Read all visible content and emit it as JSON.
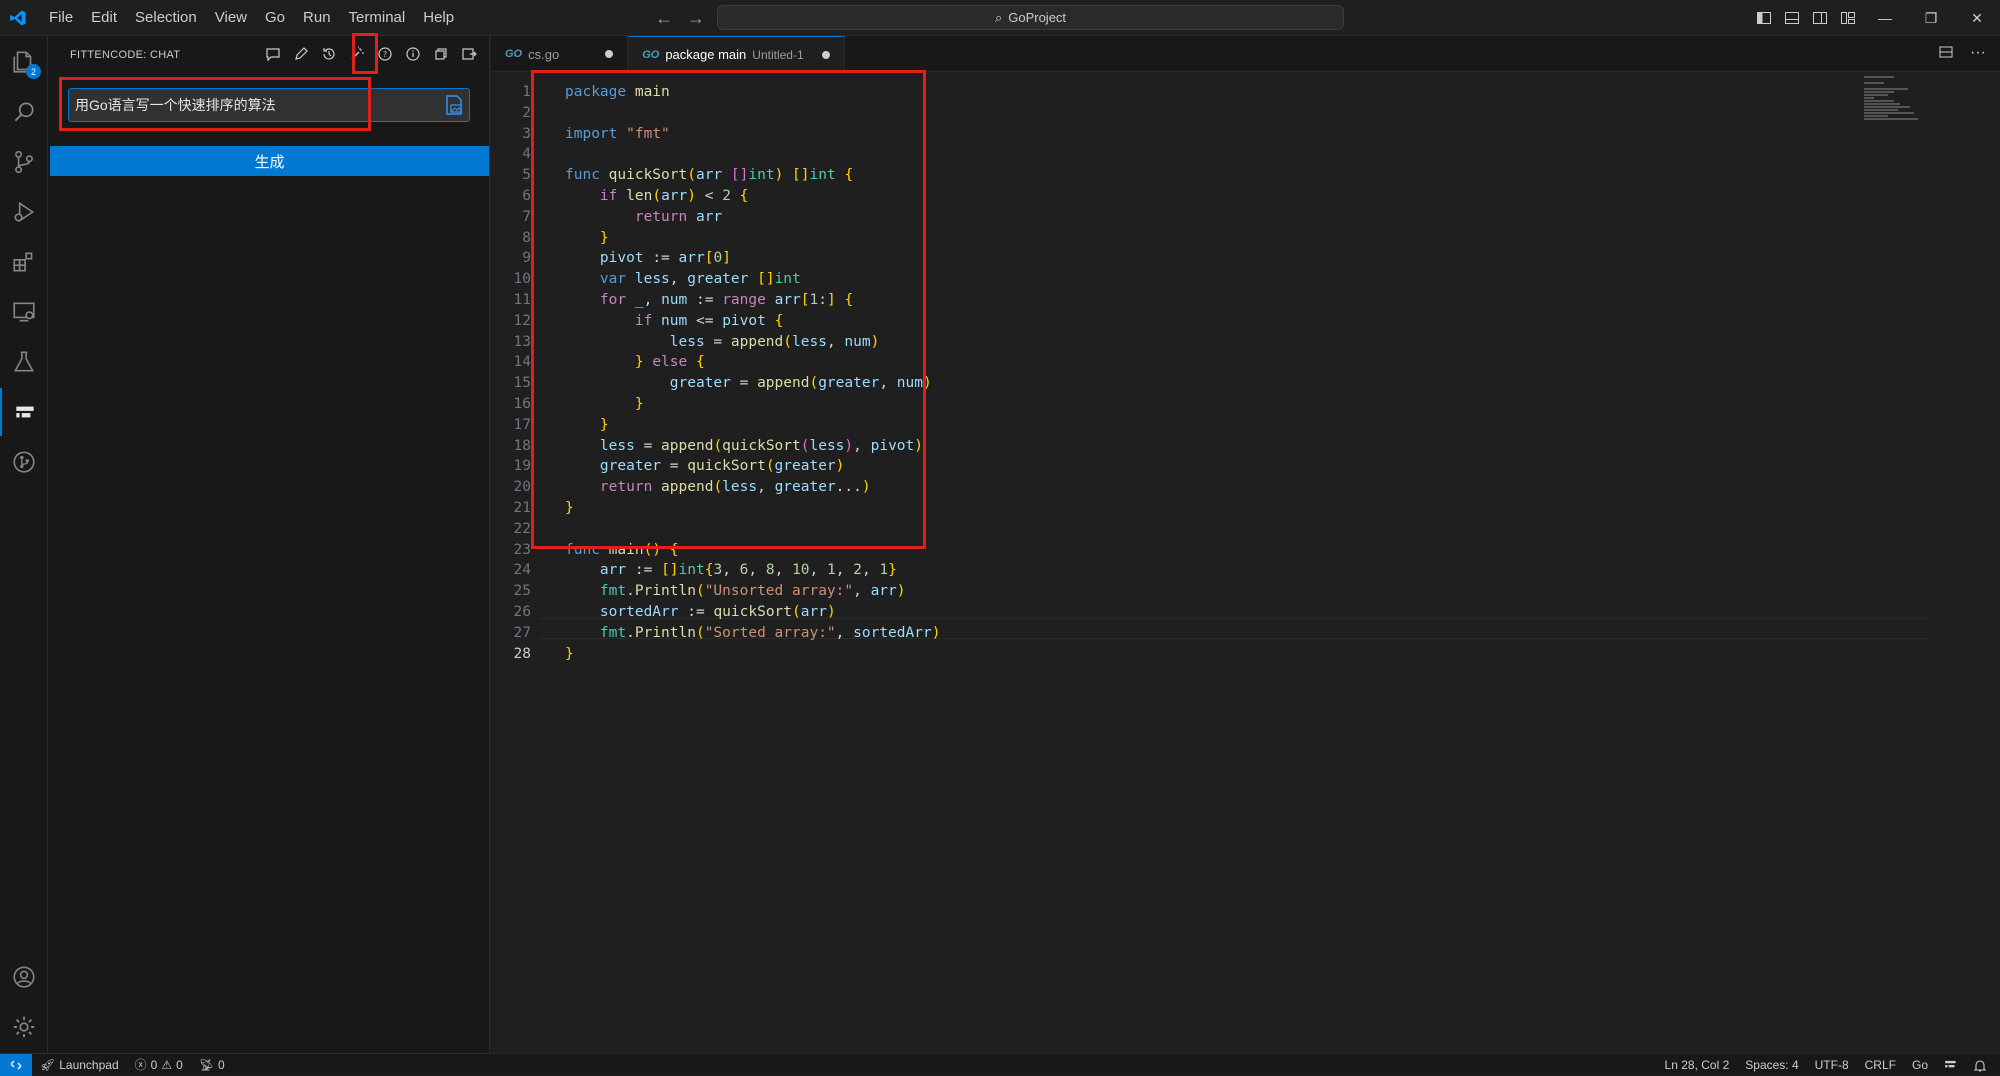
{
  "menu": [
    "File",
    "Edit",
    "Selection",
    "View",
    "Go",
    "Run",
    "Terminal",
    "Help"
  ],
  "command_center": "GoProject",
  "activity_badge": "2",
  "sidebar": {
    "title": "FITTENCODE: CHAT",
    "input_value": "用Go语言写一个快速排序的算法",
    "generate_label": "生成"
  },
  "tabs": [
    {
      "icon": "GO",
      "label": "cs.go",
      "sub": ""
    },
    {
      "icon": "GO",
      "label": "package main",
      "sub": "Untitled-1"
    }
  ],
  "code_lines": [
    {
      "n": "1",
      "t": "package main"
    },
    {
      "n": "2",
      "t": ""
    },
    {
      "n": "3",
      "t": "import \"fmt\""
    },
    {
      "n": "4",
      "t": ""
    },
    {
      "n": "5",
      "t": "func quickSort(arr []int) []int {"
    },
    {
      "n": "6",
      "t": "    if len(arr) < 2 {"
    },
    {
      "n": "7",
      "t": "        return arr"
    },
    {
      "n": "8",
      "t": "    }"
    },
    {
      "n": "9",
      "t": "    pivot := arr[0]"
    },
    {
      "n": "10",
      "t": "    var less, greater []int"
    },
    {
      "n": "11",
      "t": "    for _, num := range arr[1:] {"
    },
    {
      "n": "12",
      "t": "        if num <= pivot {"
    },
    {
      "n": "13",
      "t": "            less = append(less, num)"
    },
    {
      "n": "14",
      "t": "        } else {"
    },
    {
      "n": "15",
      "t": "            greater = append(greater, num)"
    },
    {
      "n": "16",
      "t": "        }"
    },
    {
      "n": "17",
      "t": "    }"
    },
    {
      "n": "18",
      "t": "    less = append(quickSort(less), pivot)"
    },
    {
      "n": "19",
      "t": "    greater = quickSort(greater)"
    },
    {
      "n": "20",
      "t": "    return append(less, greater...)"
    },
    {
      "n": "21",
      "t": "}"
    },
    {
      "n": "22",
      "t": ""
    },
    {
      "n": "23",
      "t": "func main() {"
    },
    {
      "n": "24",
      "t": "    arr := []int{3, 6, 8, 10, 1, 2, 1}"
    },
    {
      "n": "25",
      "t": "    fmt.Println(\"Unsorted array:\", arr)"
    },
    {
      "n": "26",
      "t": "    sortedArr := quickSort(arr)"
    },
    {
      "n": "27",
      "t": "    fmt.Println(\"Sorted array:\", sortedArr)"
    },
    {
      "n": "28",
      "t": "}"
    }
  ],
  "status": {
    "launchpad": "Launchpad",
    "errors": "0",
    "warnings": "0",
    "ports": "0",
    "position": "Ln 28, Col 2",
    "spaces": "Spaces: 4",
    "encoding": "UTF-8",
    "eol": "CRLF",
    "language": "Go"
  },
  "colors": {
    "accent": "#0078d4",
    "highlight": "#e0201b"
  }
}
